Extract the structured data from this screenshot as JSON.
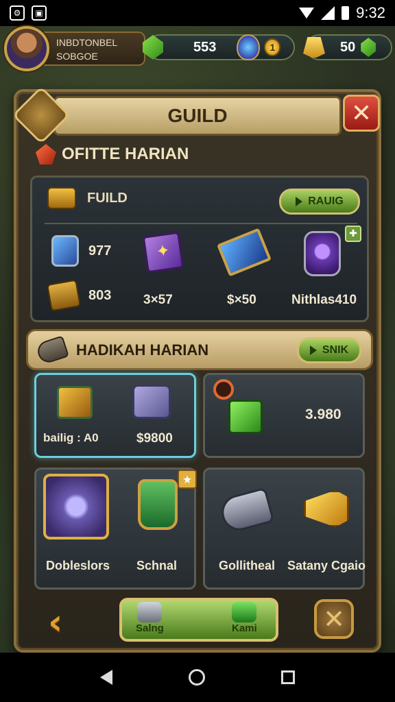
{
  "status_bar": {
    "time": "9:32"
  },
  "hud": {
    "player_name_line1": "INBDTONBEL",
    "player_name_line2": "SOBGOE",
    "resource1_value": "553",
    "resource1_badge": "1",
    "resource2_value": "50"
  },
  "panel": {
    "title": "GUILD",
    "close_label": "✕",
    "daily_title": "OFITTE HARIAN",
    "guild_box": {
      "header": "FUILD",
      "button_label": "RAUIG",
      "items": [
        {
          "value": "977"
        },
        {
          "value": "803"
        }
      ],
      "labels": [
        "3×57",
        "$×50",
        "Nithlas410"
      ]
    },
    "hadikah": {
      "title": "HADIKAH HARIAN",
      "button_label": "SNIK",
      "cards": [
        {
          "label_left": "bailig : A0",
          "label_right": "$9800"
        },
        {
          "value": "3.980"
        },
        {
          "label": "Dobleslors"
        },
        {
          "label": "Schnal"
        },
        {
          "label": "Gollitheal"
        },
        {
          "label": "Satany Cgaio"
        }
      ]
    },
    "footer": {
      "back_label": "‹",
      "btn_left": "Salng",
      "btn_right": "Kami",
      "cancel_label": "✕"
    }
  },
  "colors": {
    "accent_gold": "#c8a24a",
    "button_green": "#7aa83a",
    "close_red": "#c0302a"
  }
}
